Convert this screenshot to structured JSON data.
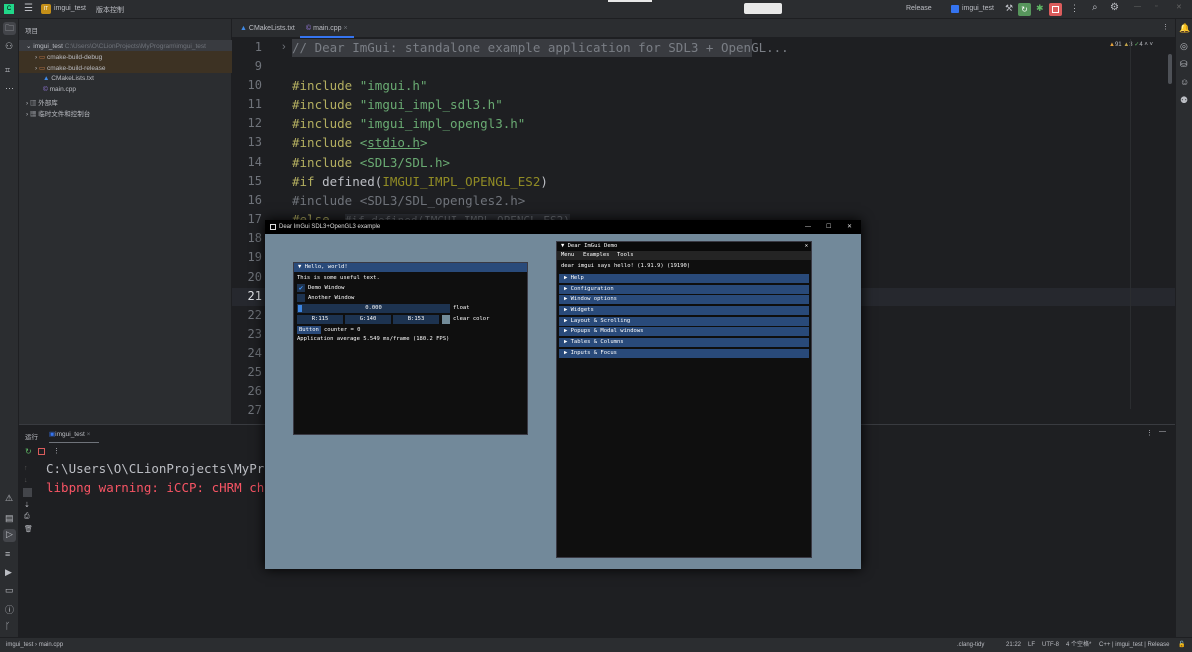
{
  "topbar": {
    "project_badge": "IT",
    "project_name": "imgui_test",
    "vcs": "版本控制",
    "config": "Release",
    "run_target": "imgui_test"
  },
  "project_panel": {
    "title": "项目",
    "items": [
      {
        "label": "imgui_test",
        "path": "C:\\Users\\O\\CLionProjects\\MyProgram\\imgui_test"
      },
      {
        "label": "cmake-build-debug"
      },
      {
        "label": "cmake-build-release"
      },
      {
        "label": "CMakeLists.txt"
      },
      {
        "label": "main.cpp"
      },
      {
        "label": "外部库"
      },
      {
        "label": "临时文件和控制台"
      }
    ]
  },
  "editor": {
    "tabs": [
      {
        "label": "CMakeLists.txt"
      },
      {
        "label": "main.cpp"
      }
    ],
    "inspections": {
      "warnings": "91",
      "weak": "3",
      "ok": "4"
    },
    "line_numbers": [
      "1",
      "9",
      "10",
      "11",
      "12",
      "13",
      "14",
      "15",
      "16",
      "17",
      "18",
      "19",
      "20",
      "21",
      "22",
      "23",
      "24",
      "25",
      "26",
      "27"
    ],
    "lines": {
      "l1": "// Dear ImGui: standalone example application for SDL3 + OpenGL...",
      "l10": "\"imgui.h\"",
      "l11": "\"imgui_impl_sdl3.h\"",
      "l12": "\"imgui_impl_opengl3.h\"",
      "l13": "stdio.h",
      "l14": "<SDL3/SDL.h>",
      "l15_macro": "IMGUI_IMPL_OPENGL_ES2",
      "l16": "#include <SDL3/SDL_opengles2.h>",
      "l17": "#else",
      "l17_hint": "#if defined(IMGUI_IMPL_OPENGL_ES2)",
      "include": "#include",
      "if": "#if",
      "defined": " defined(",
      "close": ")"
    }
  },
  "run_panel": {
    "title": "运行",
    "tab": "imgui_test",
    "output": [
      "C:\\Users\\O\\CLionProjects\\MyProgr",
      "libpng warning: iCCP: cHRM chunk"
    ]
  },
  "app_window": {
    "title": "Dear ImGui SDL3+OpenGL3 example",
    "hello": {
      "title": "Hello, world!",
      "text": "This is some useful text.",
      "demo_window": "Demo Window",
      "another_window": "Another Window",
      "slider_value": "0.000",
      "slider_label": "float",
      "slider_fraction": 0.0,
      "r": "R:115",
      "g": "G:140",
      "b": "B:153",
      "color_label": "clear color",
      "clear_color": "#738c99",
      "button": "Button",
      "counter": "counter = 0",
      "fps": "Application average 5.549 ms/frame (180.2 FPS)"
    },
    "demo": {
      "title": "Dear ImGui Demo",
      "menu": [
        "Menu",
        "Examples",
        "Tools"
      ],
      "hello": "dear imgui says hello! (1.91.9) (19190)",
      "headers": [
        "Help",
        "Configuration",
        "Window options",
        "Widgets",
        "Layout & Scrolling",
        "Popups & Modal windows",
        "Tables & Columns",
        "Inputs & Focus"
      ]
    }
  },
  "status": {
    "project": "imgui_test",
    "file": "main.cpp",
    "linter": ".clang-tidy",
    "position": "21:22",
    "line_ending": "LF",
    "encoding": "UTF-8",
    "indent": "4 个空格*",
    "context": "C++ | imgui_test | Release"
  }
}
